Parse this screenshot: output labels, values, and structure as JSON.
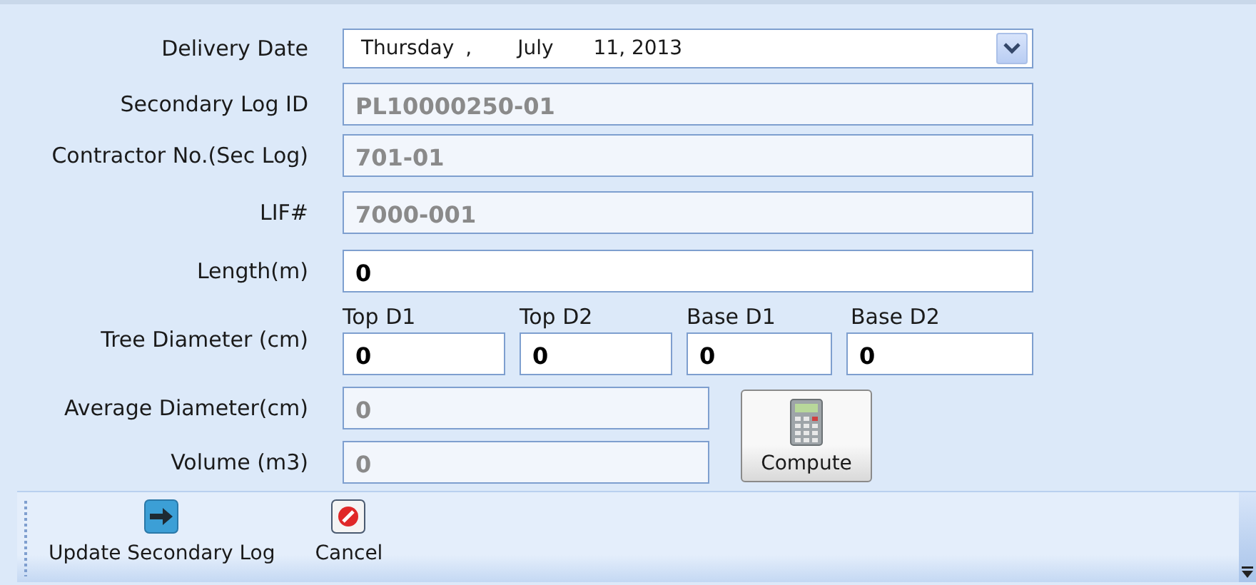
{
  "fields": [
    {
      "label": "Delivery Date",
      "kind": "date",
      "date_parts": [
        "Thursday",
        ",",
        "July",
        "11, 2013"
      ]
    },
    {
      "label": "Secondary Log ID",
      "kind": "text",
      "value": "PL10000250-01",
      "disabled": true
    },
    {
      "label": "Contractor No.(Sec Log)",
      "kind": "text",
      "value": "701-01",
      "disabled": true
    },
    {
      "label": "LIF#",
      "kind": "text",
      "value": "7000-001",
      "disabled": true
    },
    {
      "label": "Length(m)",
      "kind": "text",
      "value": "0",
      "disabled": false
    }
  ],
  "tree_diameter": {
    "label": "Tree Diameter (cm)",
    "inputs": [
      {
        "label": "Top D1",
        "value": "0"
      },
      {
        "label": "Top D2",
        "value": "0"
      },
      {
        "label": "Base D1",
        "value": "0"
      },
      {
        "label": "Base D2",
        "value": "0"
      }
    ]
  },
  "results": [
    {
      "label": "Average Diameter(cm)",
      "value": "0",
      "disabled": true
    },
    {
      "label": "Volume (m3)",
      "value": "0",
      "disabled": true
    }
  ],
  "compute_button": "Compute",
  "toolbar": [
    {
      "label": "Update Secondary Log",
      "kind": "update"
    },
    {
      "label": "Cancel",
      "kind": "cancel"
    }
  ]
}
